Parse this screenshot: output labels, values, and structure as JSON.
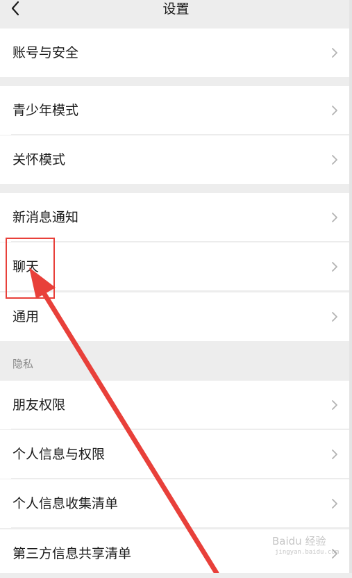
{
  "header": {
    "title": "设置",
    "back_icon": "chevron-left-icon"
  },
  "rows": {
    "account_security": "账号与安全",
    "teen_mode": "青少年模式",
    "care_mode": "关怀模式",
    "new_message_notification": "新消息通知",
    "chat": "聊天",
    "general": "通用",
    "friend_permissions": "朋友权限",
    "personal_info_permissions": "个人信息与权限",
    "personal_info_collection": "个人信息收集清单",
    "third_party_sharing": "第三方信息共享清单"
  },
  "sections": {
    "privacy": "隐私"
  },
  "annotation": {
    "highlight_color": "#e8403a",
    "arrow_color": "#e8403a"
  },
  "watermark": {
    "text": "Baidu 经验",
    "sub": "jingyan.baidu.com"
  }
}
